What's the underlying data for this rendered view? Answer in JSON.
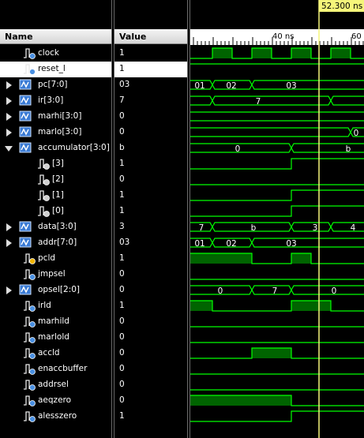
{
  "headers": {
    "name": "Name",
    "value": "Value"
  },
  "cursor": {
    "time_label": "52.300 ns",
    "color": "#f5f57a"
  },
  "ruler": {
    "ticks": [
      "40 ns",
      "60 n"
    ]
  },
  "colors": {
    "wave": "#00ff00",
    "bus_fill": "#006400",
    "grid": "#ffffff",
    "cursor": "#f5f57a"
  },
  "signals": [
    {
      "name": "clock",
      "value": "1",
      "kind": "bit",
      "icon": "input-signal-icon"
    },
    {
      "name": "reset_l",
      "value": "1",
      "kind": "bit",
      "icon": "input-signal-icon",
      "selected": true
    },
    {
      "name": "pc[7:0]",
      "value": "03",
      "kind": "bus",
      "icon": "bus-icon"
    },
    {
      "name": "ir[3:0]",
      "value": "7",
      "kind": "bus",
      "icon": "bus-icon"
    },
    {
      "name": "marhi[3:0]",
      "value": "0",
      "kind": "bus",
      "icon": "bus-icon"
    },
    {
      "name": "marlo[3:0]",
      "value": "0",
      "kind": "bus",
      "icon": "bus-icon"
    },
    {
      "name": "accumulator[3:0]",
      "value": "b",
      "kind": "bus",
      "icon": "bus-icon",
      "expanded": true
    },
    {
      "name": "[3]",
      "value": "1",
      "kind": "bit",
      "icon": "bit-signal-icon",
      "child": true
    },
    {
      "name": "[2]",
      "value": "0",
      "kind": "bit",
      "icon": "bit-signal-icon",
      "child": true
    },
    {
      "name": "[1]",
      "value": "1",
      "kind": "bit",
      "icon": "bit-signal-icon",
      "child": true
    },
    {
      "name": "[0]",
      "value": "1",
      "kind": "bit",
      "icon": "bit-signal-icon",
      "child": true
    },
    {
      "name": "data[3:0]",
      "value": "3",
      "kind": "bus",
      "icon": "bus-icon"
    },
    {
      "name": "addr[7:0]",
      "value": "03",
      "kind": "bus",
      "icon": "bus-icon"
    },
    {
      "name": "pcld",
      "value": "1",
      "kind": "bit",
      "icon": "output-signal-icon"
    },
    {
      "name": "jmpsel",
      "value": "0",
      "kind": "bit",
      "icon": "input-signal-icon"
    },
    {
      "name": "opsel[2:0]",
      "value": "0",
      "kind": "bus",
      "icon": "bus-icon"
    },
    {
      "name": "irld",
      "value": "1",
      "kind": "bit",
      "icon": "input-signal-icon"
    },
    {
      "name": "marhild",
      "value": "0",
      "kind": "bit",
      "icon": "input-signal-icon"
    },
    {
      "name": "marlold",
      "value": "0",
      "kind": "bit",
      "icon": "input-signal-icon"
    },
    {
      "name": "accld",
      "value": "0",
      "kind": "bit",
      "icon": "input-signal-icon"
    },
    {
      "name": "enaccbuffer",
      "value": "0",
      "kind": "bit",
      "icon": "input-signal-icon"
    },
    {
      "name": "addrsel",
      "value": "0",
      "kind": "bit",
      "icon": "input-signal-icon"
    },
    {
      "name": "aeqzero",
      "value": "0",
      "kind": "bit",
      "icon": "input-signal-icon"
    },
    {
      "name": "alesszero",
      "value": "1",
      "kind": "bit",
      "icon": "input-signal-icon"
    }
  ],
  "bus_segment_labels": {
    "pc": [
      "01",
      "02",
      "03"
    ],
    "ir": [
      "7"
    ],
    "marlo": [
      "0"
    ],
    "accumulator": [
      "0",
      "b"
    ],
    "data": [
      "7",
      "b",
      "3",
      "4"
    ],
    "addr": [
      "01",
      "02",
      "03"
    ],
    "opsel": [
      "0",
      "7",
      "0"
    ]
  }
}
